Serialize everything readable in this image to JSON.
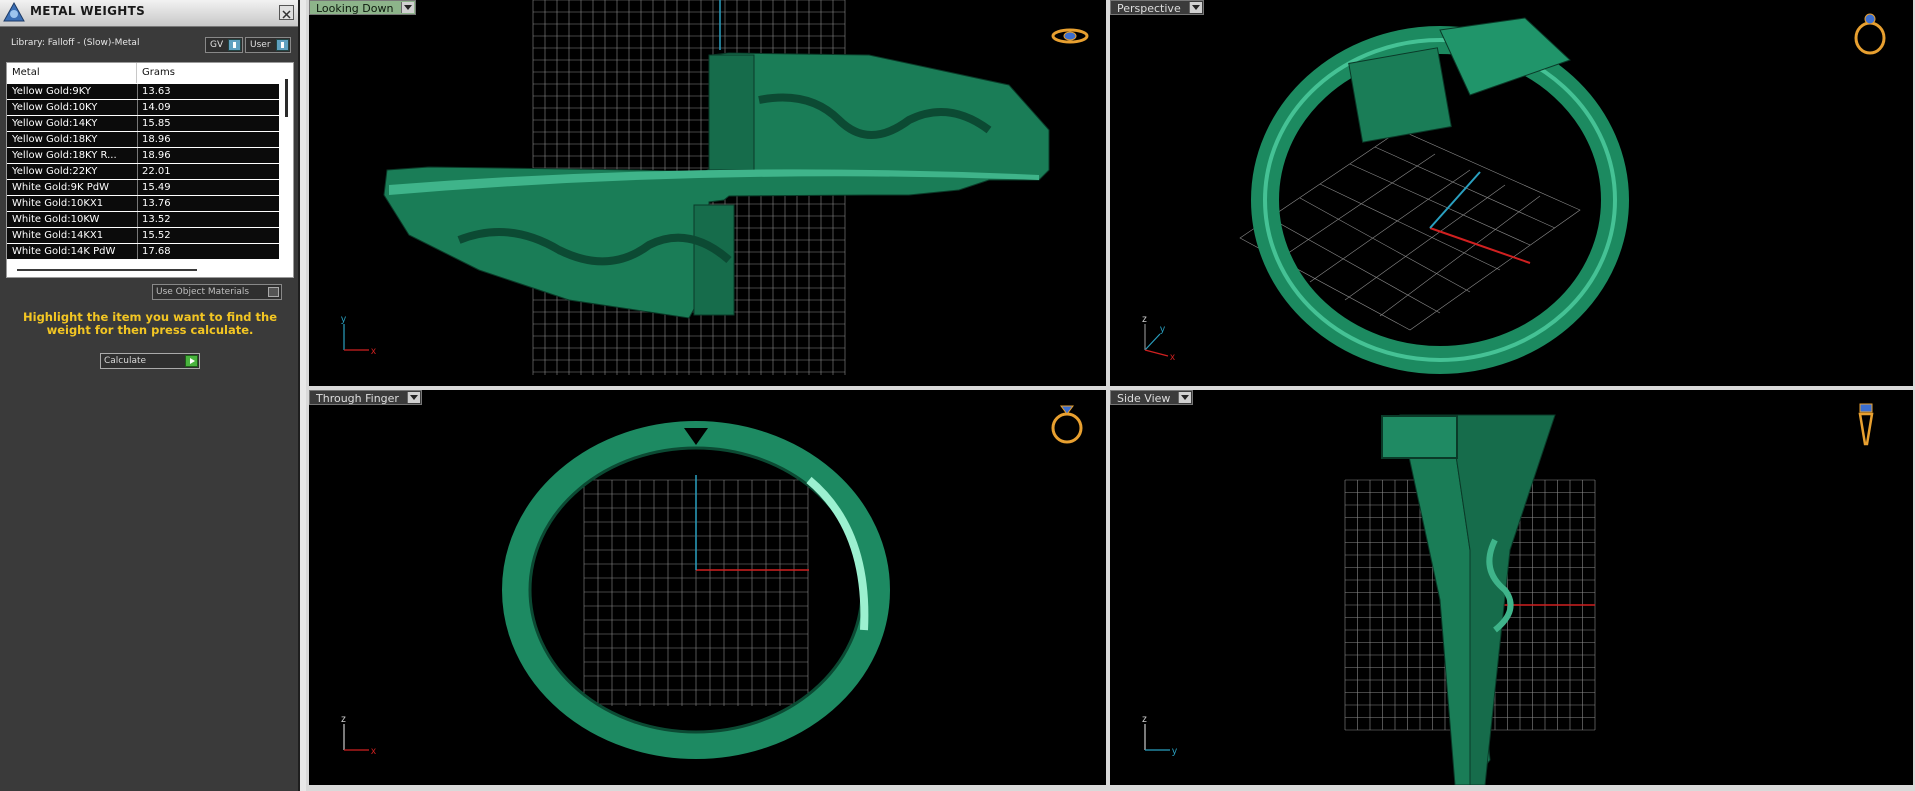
{
  "panel": {
    "title": "METAL WEIGHTS",
    "library_label": "Library: Falloff - (Slow)-Metal",
    "gv_label": "GV",
    "user_label": "User",
    "columns": [
      "Metal",
      "Grams"
    ],
    "rows": [
      {
        "metal": "Yellow Gold:9KY",
        "grams": "13.63"
      },
      {
        "metal": "Yellow Gold:10KY",
        "grams": "14.09"
      },
      {
        "metal": "Yellow Gold:14KY",
        "grams": "15.85"
      },
      {
        "metal": "Yellow Gold:18KY",
        "grams": "18.96"
      },
      {
        "metal": "Yellow Gold:18KY R...",
        "grams": "18.96"
      },
      {
        "metal": "Yellow Gold:22KY",
        "grams": "22.01"
      },
      {
        "metal": "White Gold:9K PdW",
        "grams": "15.49"
      },
      {
        "metal": "White Gold:10KX1",
        "grams": "13.76"
      },
      {
        "metal": "White Gold:10KW",
        "grams": "13.52"
      },
      {
        "metal": "White Gold:14KX1",
        "grams": "15.52"
      },
      {
        "metal": "White Gold:14K PdW",
        "grams": "17.68"
      }
    ],
    "use_object_materials": "Use Object Materials",
    "instructions": "Highlight the item you want to find the weight for then press calculate.",
    "calculate_label": "Calculate"
  },
  "viewports": {
    "top": {
      "label": "Looking Down",
      "active": true,
      "axis1": "y",
      "axis2": "x"
    },
    "perspective": {
      "label": "Perspective",
      "active": false,
      "axis1": "z",
      "axis2": "y",
      "axis3": "x"
    },
    "through_finger": {
      "label": "Through Finger",
      "active": false,
      "axis1": "z",
      "axis2": "x"
    },
    "side": {
      "label": "Side View",
      "active": false,
      "axis1": "z",
      "axis2": "y"
    }
  },
  "colors": {
    "metal_green": "#1f8a63",
    "grid": "#8a8a8a",
    "axis_x": "#d02020",
    "axis_y": "#2aa0c0",
    "instruction_text": "#f3c623",
    "ring_icon": "#e8a030"
  }
}
